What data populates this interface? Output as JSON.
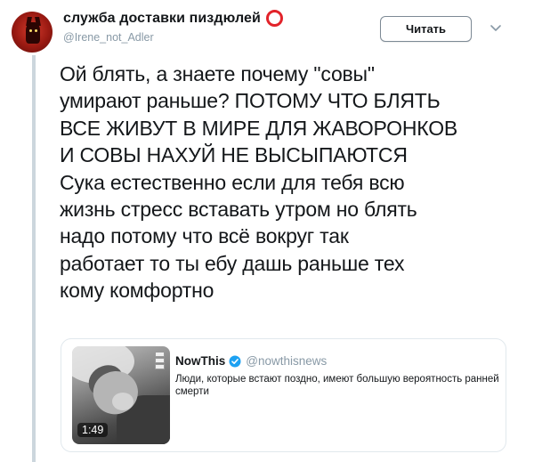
{
  "author": {
    "display_name": "служба доставки пиздюлей",
    "handle": "@Irene_not_Adler"
  },
  "follow_button_label": "Читать",
  "tweet_text": "Ой блять, а знаете почему \"совы\"\nумирают раньше? ПОТОМУ ЧТО БЛЯТЬ\nВСЕ ЖИВУТ В МИРЕ ДЛЯ ЖАВОРОНКОВ\nИ СОВЫ НАХУЙ НЕ ВЫСЫПАЮТСЯ\nСука естественно если для тебя всю\nжизнь стресс вставать утром но блять\nнадо потому что всё вокруг так\nработает то ты ебу дашь раньше тех\nкому комфортно",
  "quoted_card": {
    "author_name": "NowThis",
    "author_handle": "@nowthisnews",
    "text": "Люди, которые встают поздно, имеют большую вероятность ранней смерти",
    "video_duration": "1:49"
  },
  "icons": {
    "badge": "red-ring-icon",
    "menu": "chevron-down-icon",
    "verified": "verified-badge-icon"
  },
  "colors": {
    "badge_ring": "#e2232a",
    "verified_blue": "#1da1f2",
    "muted_text": "#8899a6"
  }
}
